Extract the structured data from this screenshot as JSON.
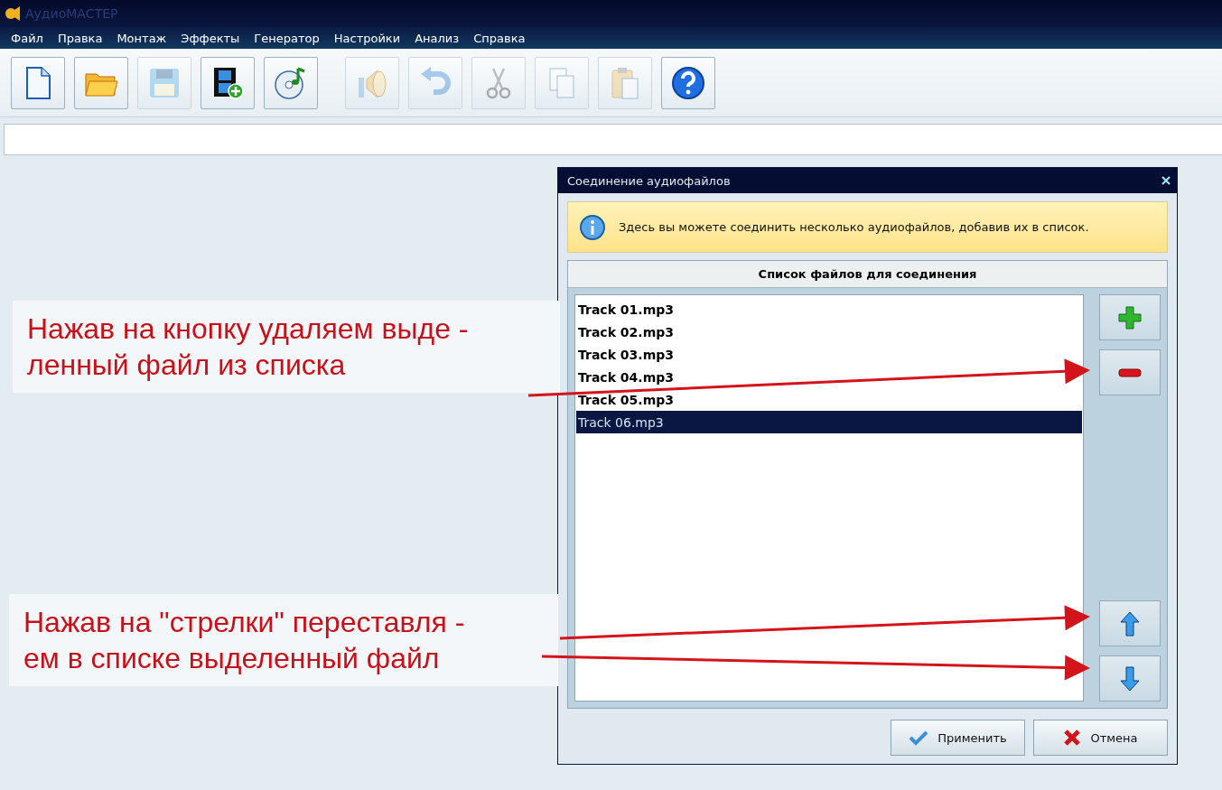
{
  "window": {
    "title": "АудиоМАСТЕР"
  },
  "menu": [
    "Файл",
    "Правка",
    "Монтаж",
    "Эффекты",
    "Генератор",
    "Настройки",
    "Анализ",
    "Справка"
  ],
  "toolbar": [
    {
      "kind": "new",
      "disabled": false
    },
    {
      "kind": "open",
      "disabled": false
    },
    {
      "kind": "save",
      "disabled": true
    },
    {
      "kind": "video",
      "disabled": false
    },
    {
      "kind": "cd",
      "disabled": false
    },
    {
      "kind": "volume",
      "disabled": true
    },
    {
      "kind": "undo",
      "disabled": true
    },
    {
      "kind": "cut",
      "disabled": true
    },
    {
      "kind": "copy",
      "disabled": true
    },
    {
      "kind": "paste",
      "disabled": true
    },
    {
      "kind": "help",
      "disabled": false
    }
  ],
  "dialog": {
    "title": "Соединение аудиофайлов",
    "info": "Здесь вы можете соединить несколько аудиофайлов, добавив их в список.",
    "list_header": "Список файлов для соединения",
    "files": [
      {
        "name": "Track 01.mp3",
        "selected": false
      },
      {
        "name": "Track 02.mp3",
        "selected": false
      },
      {
        "name": "Track 03.mp3",
        "selected": false
      },
      {
        "name": "Track 04.mp3",
        "selected": false
      },
      {
        "name": "Track 05.mp3",
        "selected": false
      },
      {
        "name": "Track 06.mp3",
        "selected": true
      }
    ],
    "side_buttons": [
      {
        "kind": "add"
      },
      {
        "kind": "remove"
      },
      {
        "kind": "up"
      },
      {
        "kind": "down"
      }
    ],
    "buttons": [
      {
        "kind": "apply",
        "label": "Применить"
      },
      {
        "kind": "cancel",
        "label": "Отмена"
      }
    ]
  },
  "annotations": [
    {
      "text": "Нажав на кнопку удаляем выде -\nленный файл из списка"
    },
    {
      "text": "Нажав на \"стрелки\" переставля -\nем в списке выделенный файл"
    }
  ]
}
